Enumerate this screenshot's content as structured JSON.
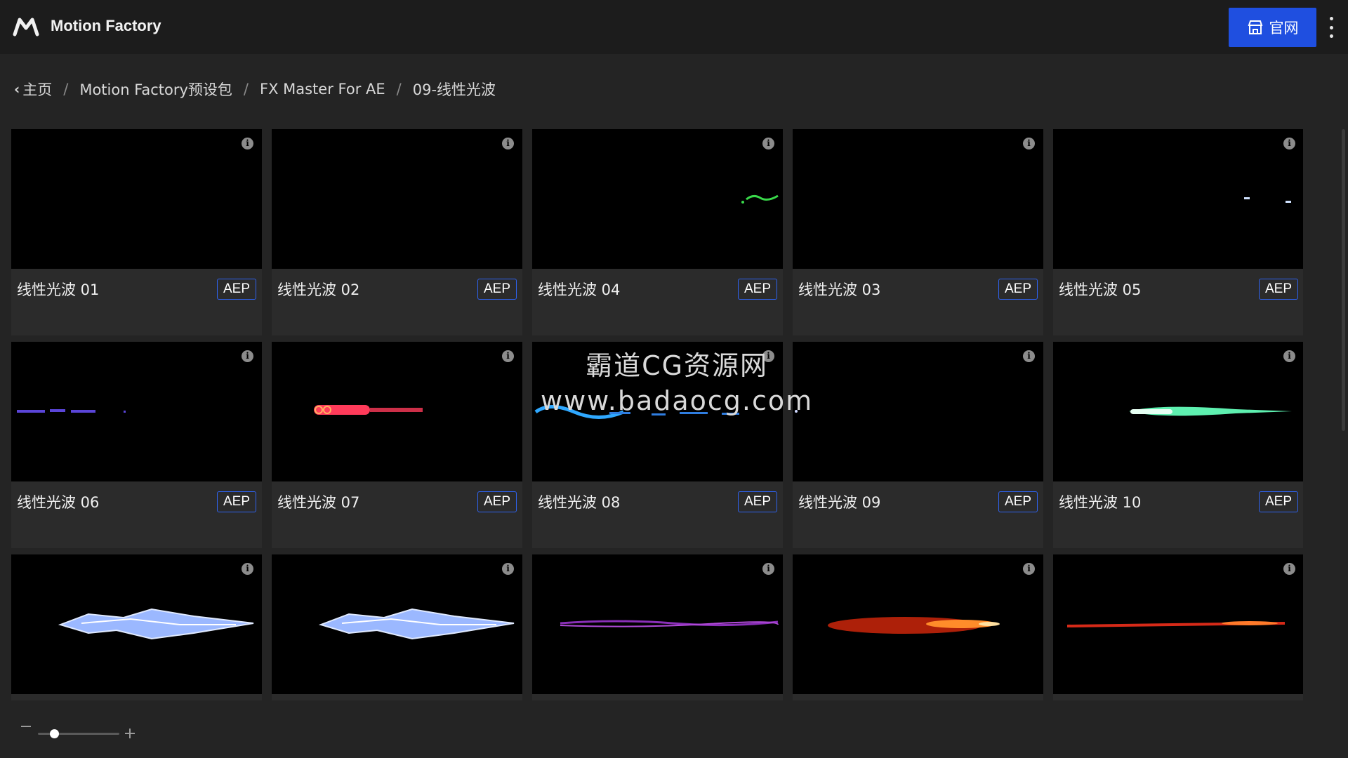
{
  "app": {
    "title": "Motion Factory",
    "logo_icon": "mf-logo-icon"
  },
  "header": {
    "site_button_label": "官网",
    "site_button_icon": "store-icon",
    "menu_icon": "kebab-menu-icon",
    "accent": "#1f4fe0"
  },
  "breadcrumb": {
    "home": "主页",
    "items": [
      "Motion Factory预设包",
      "FX Master For AE",
      "09-线性光波"
    ],
    "separator": "/"
  },
  "cards": [
    {
      "title": "线性光波 01",
      "badge": "AEP",
      "effect": "none"
    },
    {
      "title": "线性光波 02",
      "badge": "AEP",
      "effect": "none"
    },
    {
      "title": "线性光波 04",
      "badge": "AEP",
      "effect": "green-squiggle"
    },
    {
      "title": "线性光波 03",
      "badge": "AEP",
      "effect": "none"
    },
    {
      "title": "线性光波 05",
      "badge": "AEP",
      "effect": "blue-dots"
    },
    {
      "title": "线性光波 06",
      "badge": "AEP",
      "effect": "purple-dashes"
    },
    {
      "title": "线性光波 07",
      "badge": "AEP",
      "effect": "red-beam"
    },
    {
      "title": "线性光波 08",
      "badge": "AEP",
      "effect": "blue-wave"
    },
    {
      "title": "线性光波 09",
      "badge": "AEP",
      "effect": "dot"
    },
    {
      "title": "线性光波 10",
      "badge": "AEP",
      "effect": "green-beam"
    },
    {
      "title": "",
      "badge": "",
      "effect": "ice-crystal"
    },
    {
      "title": "",
      "badge": "",
      "effect": "ice-crystal"
    },
    {
      "title": "",
      "badge": "",
      "effect": "purple-thread"
    },
    {
      "title": "",
      "badge": "",
      "effect": "fire-streak"
    },
    {
      "title": "",
      "badge": "",
      "effect": "red-thin-beam"
    }
  ],
  "watermark": {
    "line1": "霸道CG资源网",
    "line2": "www.badaocg.com"
  },
  "footer": {
    "zoom_level": 0.2
  }
}
